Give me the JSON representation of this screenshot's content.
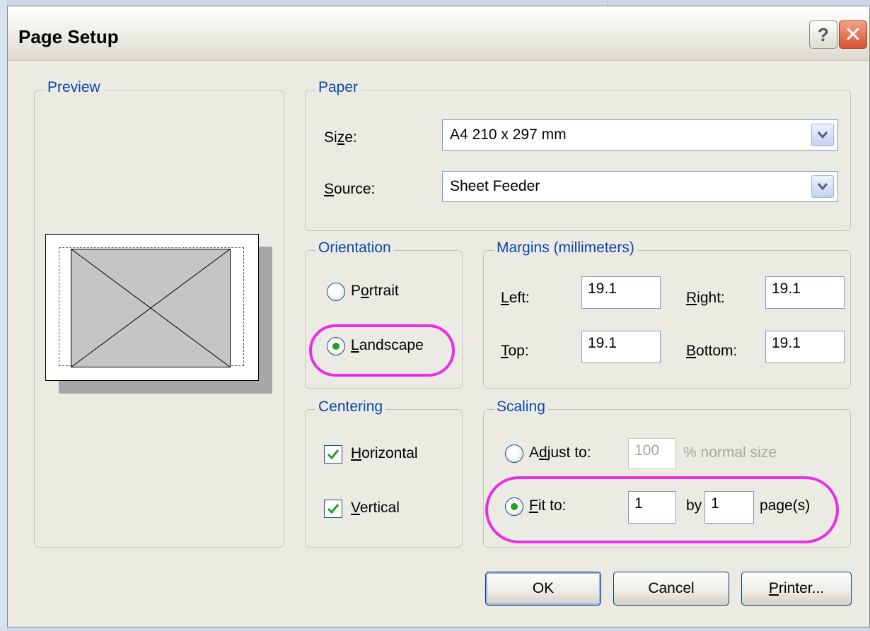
{
  "dialog": {
    "title": "Page Setup",
    "help_label": "?",
    "close_label": "✕"
  },
  "preview": {
    "legend": "Preview"
  },
  "paper": {
    "legend": "Paper",
    "size_label_pre": "Si",
    "size_label_ul": "z",
    "size_label_post": "e:",
    "size_value": "A4 210 x 297 mm",
    "source_label_ul": "S",
    "source_label_post": "ource:",
    "source_value": "Sheet Feeder"
  },
  "orientation": {
    "legend": "Orientation",
    "portrait_pre": "P",
    "portrait_ul": "o",
    "portrait_post": "rtrait",
    "landscape_ul": "L",
    "landscape_post": "andscape",
    "selected": "landscape"
  },
  "margins": {
    "legend": "Margins (millimeters)",
    "left_label_ul": "L",
    "left_label_post": "eft:",
    "left_value": "19.1",
    "right_label_ul": "R",
    "right_label_post": "ight:",
    "right_value": "19.1",
    "top_label_ul": "T",
    "top_label_post": "op:",
    "top_value": "19.1",
    "bottom_label_ul": "B",
    "bottom_label_post": "ottom:",
    "bottom_value": "19.1"
  },
  "centering": {
    "legend": "Centering",
    "horizontal_ul": "H",
    "horizontal_post": "orizontal",
    "horizontal_checked": true,
    "vertical_ul": "V",
    "vertical_post": "ertical",
    "vertical_checked": true
  },
  "scaling": {
    "legend": "Scaling",
    "adjust_pre": "A",
    "adjust_ul": "d",
    "adjust_post": "just to:",
    "adjust_value": "100",
    "adjust_suffix": "% normal size",
    "fit_ul": "F",
    "fit_post": "it to:",
    "fit_wide": "1",
    "by_label": "by",
    "fit_tall": "1",
    "pages_label": "page(s)",
    "selected": "fit"
  },
  "buttons": {
    "ok": "OK",
    "cancel": "Cancel",
    "printer_ul": "P",
    "printer_post": "rinter..."
  },
  "colors": {
    "annotation": "#e82fe4",
    "legend_text": "#0a47a8",
    "dialog_bg": "#ecebe3"
  }
}
